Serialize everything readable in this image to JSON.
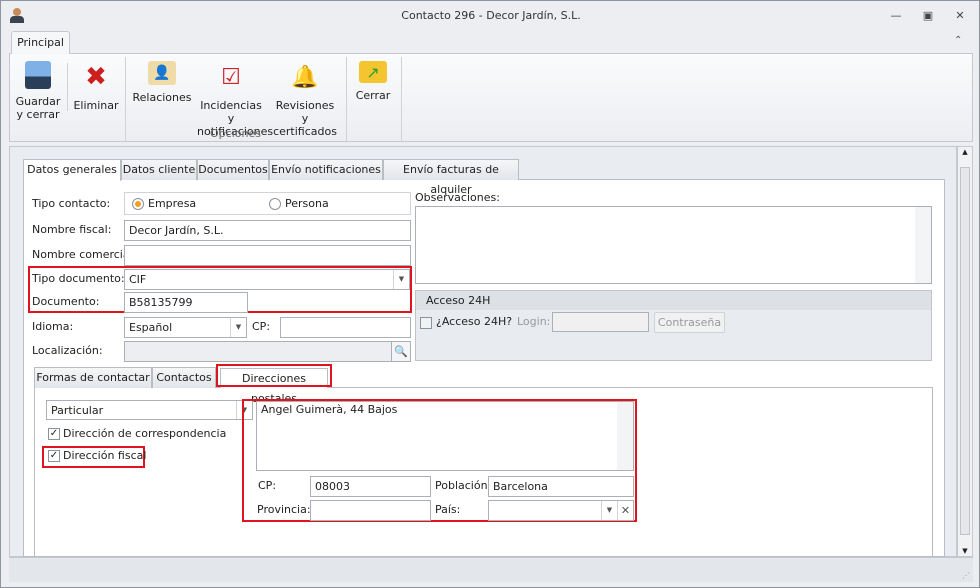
{
  "window": {
    "title": "Contacto 296 - Decor Jardín, S.L."
  },
  "ribbon": {
    "tab": "Principal",
    "buttons": {
      "save": "Guardar\ny cerrar",
      "delete": "Eliminar",
      "relations": "Relaciones",
      "incidents": "Incidencias y\nnotificaciones",
      "revisions": "Revisiones y\ncertificados",
      "close": "Cerrar"
    },
    "group_label": "Opciones"
  },
  "tabs": [
    "Datos generales",
    "Datos cliente",
    "Documentos",
    "Envío notificaciones",
    "Envío facturas de alquiler"
  ],
  "form": {
    "tipo_contacto_label": "Tipo contacto:",
    "radio_empresa": "Empresa",
    "radio_persona": "Persona",
    "nombre_fiscal_label": "Nombre fiscal:",
    "nombre_fiscal": "Decor Jardín, S.L.",
    "nombre_comercial_label": "Nombre comercial:",
    "nombre_comercial": "",
    "tipo_documento_label": "Tipo documento:",
    "tipo_documento": "CIF",
    "documento_label": "Documento:",
    "documento": "B58135799",
    "idioma_label": "Idioma:",
    "idioma": "Español",
    "cp_label": "CP:",
    "cp": "",
    "localizacion_label": "Localización:",
    "localizacion": "",
    "observaciones_label": "Observaciones:",
    "acceso": {
      "title": "Acceso 24H",
      "checkbox": "¿Acceso 24H?",
      "login_label": "Login:",
      "password_button": "Contraseña"
    }
  },
  "subtabs": [
    "Formas de contactar",
    "Contactos",
    "Direcciones postales"
  ],
  "address": {
    "type": "Particular",
    "correspondencia": "Dirección de correspondencia",
    "fiscal": "Dirección fiscal",
    "street": "Angel Guimerà, 44 Bajos",
    "cp_label": "CP:",
    "cp": "08003",
    "poblacion_label": "Población:",
    "poblacion": "Barcelona",
    "provincia_label": "Provincia:",
    "provincia": "",
    "pais_label": "País:",
    "pais": ""
  }
}
